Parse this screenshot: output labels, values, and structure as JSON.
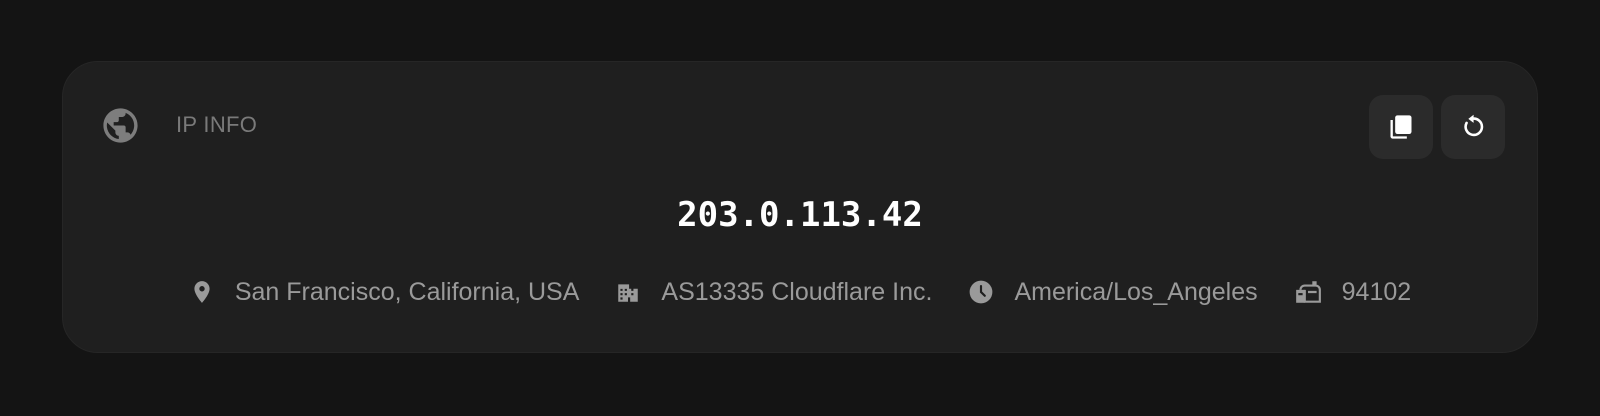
{
  "card": {
    "title": "IP INFO",
    "icon": "globe-icon",
    "actions": [
      {
        "name": "copy",
        "icon": "copy-icon"
      },
      {
        "name": "refresh",
        "icon": "refresh-icon"
      }
    ]
  },
  "ip": "203.0.113.42",
  "details": {
    "location": "San Francisco, California, USA",
    "isp": "AS13335 Cloudflare Inc.",
    "timezone": "America/Los_Angeles",
    "postal": "94102"
  },
  "colors": {
    "background": "#141414",
    "card": "#1f1f1f",
    "button": "#2b2b2b",
    "muted_text": "#9a9a9a",
    "primary_text": "#ffffff"
  }
}
